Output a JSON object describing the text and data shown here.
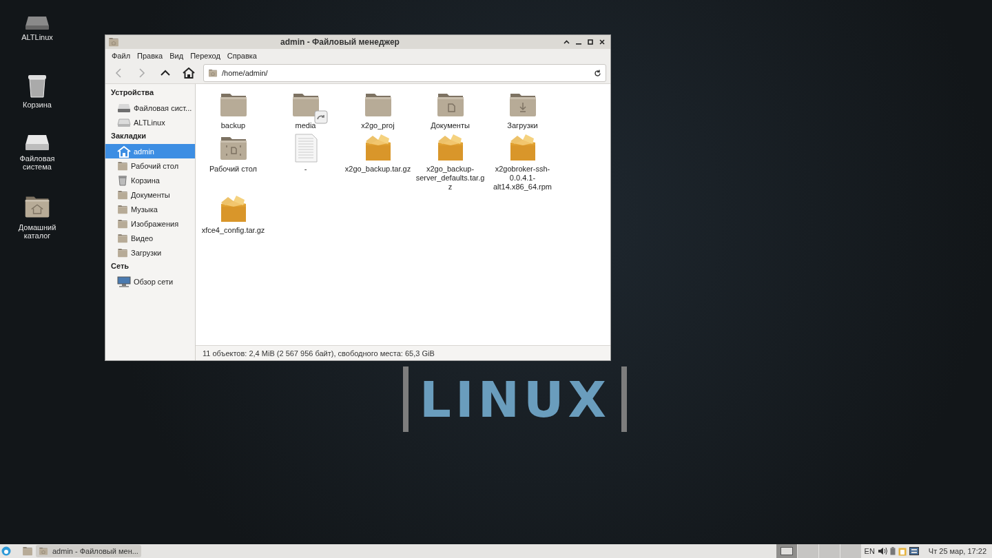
{
  "desktop": {
    "icons": [
      {
        "label": "ALTLinux",
        "kind": "drive"
      },
      {
        "label": "Корзина",
        "kind": "trash"
      },
      {
        "label": "Файловая система",
        "kind": "harddisk"
      },
      {
        "label": "Домашний каталог",
        "kind": "home"
      }
    ],
    "wallpaper": {
      "logo_text": "LINUX"
    }
  },
  "window": {
    "title": "admin - Файловый менеджер",
    "menu": [
      "Файл",
      "Правка",
      "Вид",
      "Переход",
      "Справка"
    ],
    "location": "/home/admin/",
    "sidebar": [
      {
        "heading": "Устройства",
        "items": [
          {
            "label": "Файловая сист...",
            "kind": "harddisk",
            "selected": false
          },
          {
            "label": "ALTLinux",
            "kind": "drive",
            "selected": false
          }
        ]
      },
      {
        "heading": "Закладки",
        "items": [
          {
            "label": "admin",
            "kind": "home",
            "selected": true
          },
          {
            "label": "Рабочий стол",
            "kind": "folder",
            "selected": false
          },
          {
            "label": "Корзина",
            "kind": "trash",
            "selected": false
          },
          {
            "label": "Документы",
            "kind": "folder",
            "selected": false
          },
          {
            "label": "Музыка",
            "kind": "folder",
            "selected": false
          },
          {
            "label": "Изображения",
            "kind": "folder",
            "selected": false
          },
          {
            "label": "Видео",
            "kind": "folder",
            "selected": false
          },
          {
            "label": "Загрузки",
            "kind": "folder",
            "selected": false
          }
        ]
      },
      {
        "heading": "Сеть",
        "items": [
          {
            "label": "Обзор сети",
            "kind": "network",
            "selected": false
          }
        ]
      }
    ],
    "files": [
      {
        "name": "backup",
        "kind": "folder"
      },
      {
        "name": "media",
        "kind": "folder-link"
      },
      {
        "name": "x2go_proj",
        "kind": "folder"
      },
      {
        "name": "Документы",
        "kind": "folder-documents"
      },
      {
        "name": "Загрузки",
        "kind": "folder-downloads"
      },
      {
        "name": "Рабочий стол",
        "kind": "folder-desktop"
      },
      {
        "name": "-",
        "kind": "text"
      },
      {
        "name": "x2go_backup.tar.gz",
        "kind": "archive"
      },
      {
        "name": "x2go_backup-server_defaults.tar.gz",
        "kind": "archive"
      },
      {
        "name": "x2gobroker-ssh-0.0.4.1-alt14.x86_64.rpm",
        "kind": "archive"
      },
      {
        "name": "xfce4_config.tar.gz",
        "kind": "archive"
      }
    ],
    "status_bar": "11 объектов: 2,4 MiB (2 567 956 байт), свободного места: 65,3 GiB"
  },
  "taskbar": {
    "tasks": [
      {
        "label": "admin - Файловый мен...",
        "selected": true
      }
    ],
    "workspaces": [
      {
        "selected": true
      },
      {
        "selected": false
      },
      {
        "selected": false
      },
      {
        "selected": false
      }
    ],
    "layout": "EN",
    "clock": "Чт 25 мар, 17:22"
  }
}
